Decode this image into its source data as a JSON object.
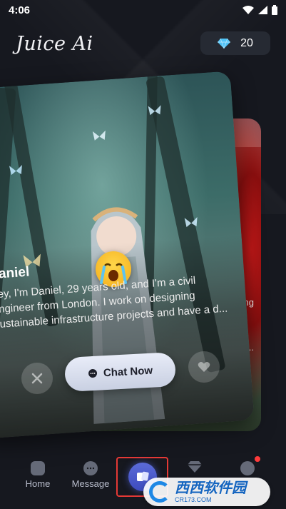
{
  "status_bar": {
    "time": "4:06"
  },
  "header": {
    "logo": "Juice Ai",
    "gems": "20"
  },
  "back_card": {
    "text_line1": "rking",
    "text_line2": "and..."
  },
  "card": {
    "name": "aniel",
    "bio_line1": "ey, I'm Daniel, 29 years old, and I'm a civil",
    "bio_line2": "ngineer from London. I work on designing",
    "bio_line3": "ustainable infrastructure projects and have a d...",
    "chat_label": "Chat Now"
  },
  "nav": {
    "items": [
      {
        "label": "Home"
      },
      {
        "label": "Message"
      },
      {
        "label": ""
      },
      {
        "label": ""
      },
      {
        "label": ""
      }
    ]
  },
  "watermark": {
    "main": "西西软件园",
    "sub": "CR173.COM"
  },
  "colors": {
    "accent": "#4a5bd0",
    "highlight_border": "#e53935",
    "notif": "#ff3b3b"
  }
}
